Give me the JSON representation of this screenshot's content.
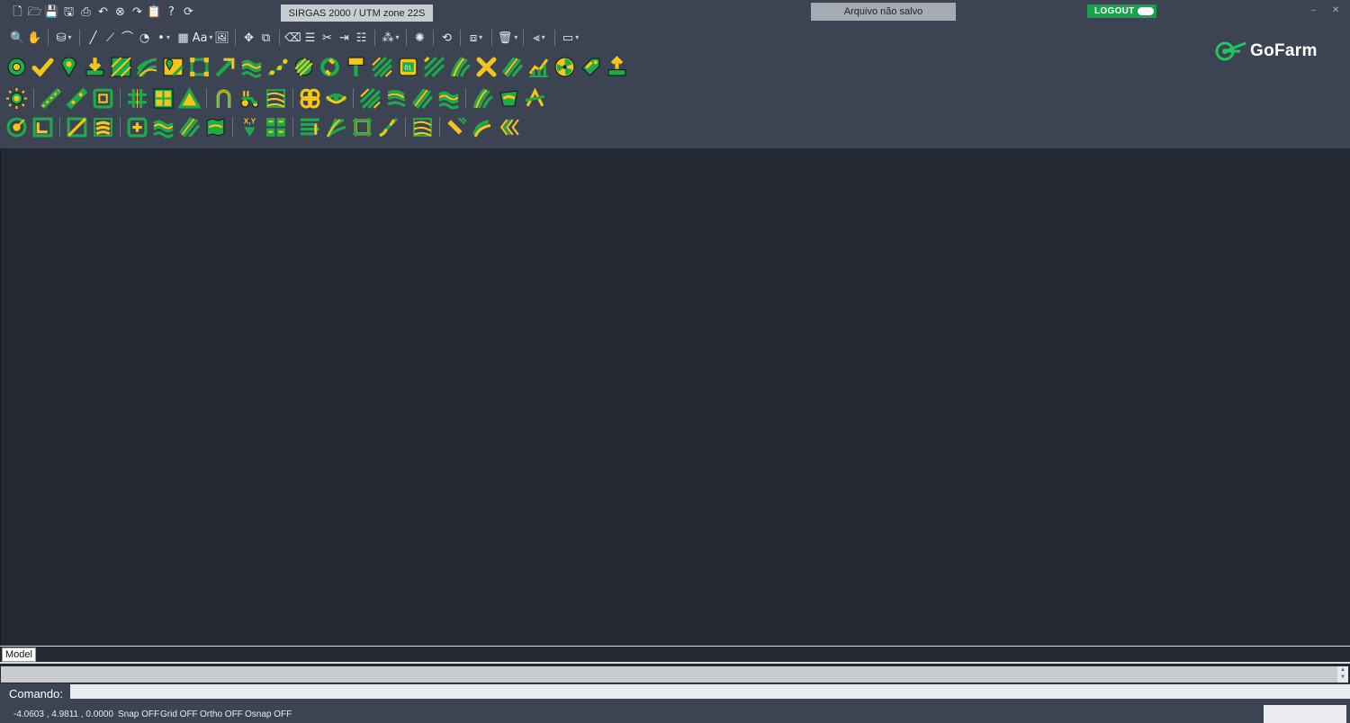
{
  "app": {
    "coord_system": "SIRGAS 2000 / UTM zone 22S",
    "file_status": "Arquivo não salvo",
    "logout_label": "LOGOUT",
    "logo_text": "GoFarm",
    "minimize_glyph": "–",
    "close_glyph": "✕"
  },
  "toolbar_std": [
    {
      "name": "new-file-icon",
      "glyph": "🗋"
    },
    {
      "name": "open-file-icon",
      "glyph": "🗁"
    },
    {
      "name": "save-icon",
      "glyph": "💾"
    },
    {
      "name": "save-as-icon",
      "glyph": "🖫"
    },
    {
      "name": "print-icon",
      "glyph": "⎙"
    },
    {
      "name": "undo-icon",
      "glyph": "↶"
    },
    {
      "name": "cancel-icon",
      "glyph": "⊗"
    },
    {
      "name": "redo-icon",
      "glyph": "↷"
    },
    {
      "name": "clipboard-icon",
      "glyph": "📋"
    },
    {
      "name": "help-icon",
      "glyph": "?"
    },
    {
      "name": "refresh-icon",
      "glyph": "⟳"
    }
  ],
  "toolbar_draw": [
    {
      "name": "zoom-icon",
      "glyph": "🔍"
    },
    {
      "name": "pan-icon",
      "glyph": "✋"
    },
    {
      "sep": true
    },
    {
      "name": "layers-icon",
      "glyph": "⛁",
      "dd": true
    },
    {
      "sep": true
    },
    {
      "name": "line-icon",
      "glyph": "╱"
    },
    {
      "name": "polyline-icon",
      "glyph": "⟋"
    },
    {
      "name": "arc-icon",
      "glyph": "⌒"
    },
    {
      "name": "circle-icon",
      "glyph": "◔"
    },
    {
      "name": "point-icon",
      "glyph": "•",
      "dd": true
    },
    {
      "name": "hatch-icon",
      "glyph": "▦"
    },
    {
      "name": "text-icon",
      "glyph": "Aa",
      "dd": true
    },
    {
      "name": "image-icon",
      "glyph": "🖼"
    },
    {
      "sep": true
    },
    {
      "name": "move-icon",
      "glyph": "✥"
    },
    {
      "name": "copy-icon",
      "glyph": "⧉"
    },
    {
      "sep": true
    },
    {
      "name": "erase-icon",
      "glyph": "⌫"
    },
    {
      "name": "properties-icon",
      "glyph": "☰"
    },
    {
      "name": "trim-icon",
      "glyph": "✂"
    },
    {
      "name": "extend-icon",
      "glyph": "⇥"
    },
    {
      "name": "offset-icon",
      "glyph": "☷"
    },
    {
      "sep": true
    },
    {
      "name": "snap-icon",
      "glyph": "⁂",
      "dd": true
    },
    {
      "sep": true
    },
    {
      "name": "explode-icon",
      "glyph": "✺"
    },
    {
      "sep": true
    },
    {
      "name": "match-icon",
      "glyph": "⟲"
    },
    {
      "sep": true
    },
    {
      "name": "block-icon",
      "glyph": "⧈",
      "dd": true
    },
    {
      "sep": true
    },
    {
      "name": "delete-icon",
      "glyph": "🗑",
      "dd": true
    },
    {
      "sep": true
    },
    {
      "name": "measure-icon",
      "glyph": "⫷",
      "dd": true
    },
    {
      "sep": true
    },
    {
      "name": "viewport-icon",
      "glyph": "▭",
      "dd": true
    }
  ],
  "farm_row1": [
    {
      "name": "settings-gear-icon",
      "shape": "gear"
    },
    {
      "name": "confirm-check-icon",
      "shape": "check"
    },
    {
      "name": "location-pin-icon",
      "shape": "pin"
    },
    {
      "name": "import-download-icon",
      "shape": "down"
    },
    {
      "name": "field-grid-icon",
      "shape": "hatch"
    },
    {
      "name": "curved-lines-icon",
      "shape": "curves"
    },
    {
      "name": "map-pin-area-icon",
      "shape": "mappin"
    },
    {
      "name": "polygon-nodes-icon",
      "shape": "nodes"
    },
    {
      "name": "path-arrow-icon",
      "shape": "arrow"
    },
    {
      "name": "wave-lines-icon",
      "shape": "waves"
    },
    {
      "name": "dotted-path-icon",
      "shape": "dots"
    },
    {
      "name": "hatched-circle-icon",
      "shape": "hcircle"
    },
    {
      "name": "cycle-icon",
      "shape": "cycle"
    },
    {
      "name": "brush-icon",
      "shape": "brush"
    },
    {
      "name": "diagonal-rows-icon",
      "shape": "diag"
    },
    {
      "name": "numbered-plot-icon",
      "shape": "num"
    },
    {
      "name": "corner-rows-icon",
      "shape": "corner"
    },
    {
      "name": "parallel-curves-icon",
      "shape": "pcurves"
    },
    {
      "name": "remove-x-icon",
      "shape": "x"
    },
    {
      "name": "slanted-rows-icon",
      "shape": "slant"
    },
    {
      "name": "growth-chart-icon",
      "shape": "chart"
    },
    {
      "name": "radiation-icon",
      "shape": "rad"
    },
    {
      "name": "tag-icon",
      "shape": "tag"
    },
    {
      "name": "export-upload-icon",
      "shape": "up"
    }
  ],
  "farm_row2": [
    {
      "name": "sun-gear-icon",
      "shape": "sun"
    },
    {
      "sep": true
    },
    {
      "name": "pencil-line-icon",
      "shape": "pencil"
    },
    {
      "name": "ruler-icon",
      "shape": "ruler"
    },
    {
      "name": "square-target-icon",
      "shape": "sqtarget"
    },
    {
      "sep": true
    },
    {
      "name": "grid-lines-icon",
      "shape": "gridlines"
    },
    {
      "name": "window-blocks-icon",
      "shape": "window"
    },
    {
      "name": "triangle-icon",
      "shape": "triangle"
    },
    {
      "sep": true
    },
    {
      "name": "u-turn-icon",
      "shape": "uturn"
    },
    {
      "name": "tractor-icon",
      "shape": "tractor"
    },
    {
      "name": "boundary-rows-icon",
      "shape": "brows"
    },
    {
      "sep": true
    },
    {
      "name": "clover-icon",
      "shape": "clover"
    },
    {
      "name": "eye-path-icon",
      "shape": "eye"
    },
    {
      "sep": true
    },
    {
      "name": "slope-rows-icon",
      "shape": "diag"
    },
    {
      "name": "contour-rows-icon",
      "shape": "contour"
    },
    {
      "name": "dense-rows-icon",
      "shape": "slant"
    },
    {
      "name": "swept-rows-icon",
      "shape": "waves"
    },
    {
      "sep": true
    },
    {
      "name": "arc-rows-icon",
      "shape": "pcurves"
    },
    {
      "name": "bucket-icon",
      "shape": "bucket"
    },
    {
      "name": "angle-tool-icon",
      "shape": "angle"
    }
  ],
  "farm_row3": [
    {
      "name": "radar-target-icon",
      "shape": "radar"
    },
    {
      "name": "corner-frame-icon",
      "shape": "cframe"
    },
    {
      "sep": true
    },
    {
      "name": "split-square-icon",
      "shape": "split"
    },
    {
      "name": "boxed-waves-icon",
      "shape": "bwaves"
    },
    {
      "sep": true
    },
    {
      "name": "add-plot-icon",
      "shape": "plus"
    },
    {
      "name": "flowing-rows-icon",
      "shape": "waves"
    },
    {
      "name": "stacked-rows-icon",
      "shape": "slant"
    },
    {
      "name": "folded-map-icon",
      "shape": "folded"
    },
    {
      "sep": true
    },
    {
      "name": "xy-coordinate-icon",
      "shape": "xy"
    },
    {
      "name": "block-grid-icon",
      "shape": "blockgrid"
    },
    {
      "sep": true
    },
    {
      "name": "list-rows-icon",
      "shape": "list"
    },
    {
      "name": "fan-rows-icon",
      "shape": "fan"
    },
    {
      "name": "framed-square-icon",
      "shape": "frame"
    },
    {
      "name": "diagonal-cut-icon",
      "shape": "dcut"
    },
    {
      "sep": true
    },
    {
      "name": "merge-rows-icon",
      "shape": "brows"
    },
    {
      "sep": true
    },
    {
      "name": "spray-icon",
      "shape": "spray"
    },
    {
      "name": "hand-path-icon",
      "shape": "hand"
    },
    {
      "name": "chevron-rows-icon",
      "shape": "chev"
    }
  ],
  "tabs": {
    "model": "Model"
  },
  "command": {
    "label": "Comando:",
    "value": ""
  },
  "status": {
    "coords": "-4.0603 , 4.9811 , 0.0000",
    "snap": "Snap OFF",
    "grid": "Grid OFF",
    "ortho": "Ortho OFF",
    "osnap": "Osnap OFF"
  },
  "colors": {
    "bg": "#232833",
    "toolbar": "#3c4453",
    "green": "#16a34a",
    "yellow": "#f5c518",
    "accent": "#1faa4a"
  }
}
